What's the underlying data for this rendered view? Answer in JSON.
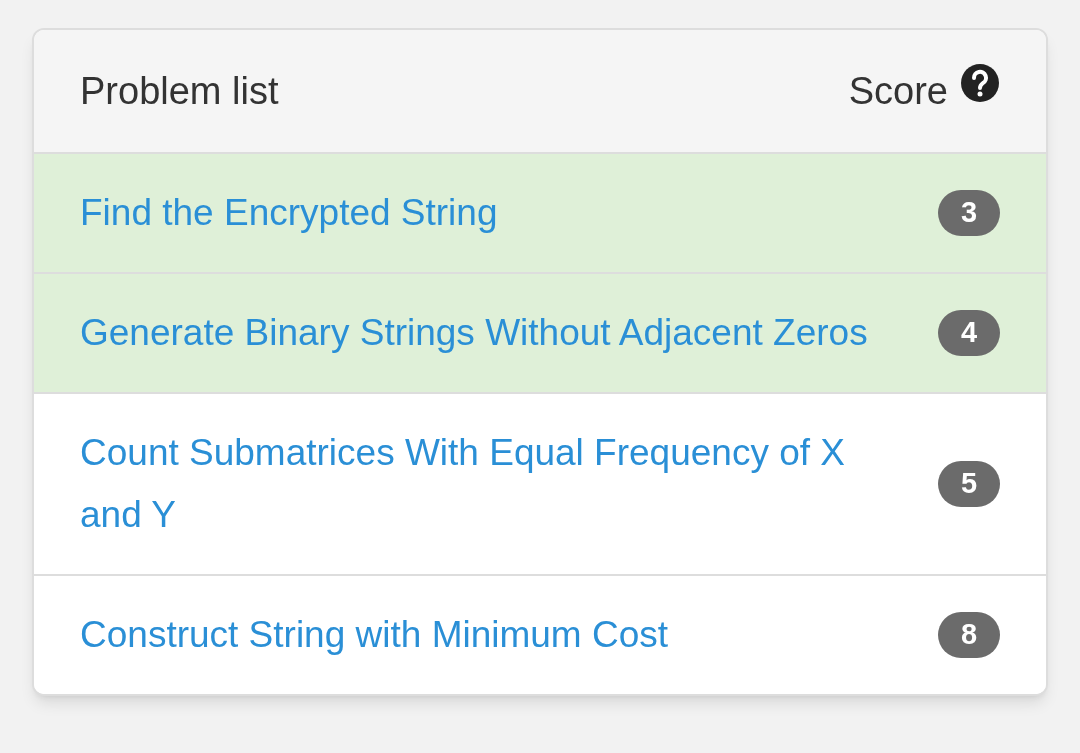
{
  "header": {
    "title": "Problem list",
    "score_label": "Score"
  },
  "problems": [
    {
      "title": "Find the Encrypted String",
      "score": "3",
      "solved": true
    },
    {
      "title": "Generate Binary Strings Without Adjacent Zeros",
      "score": "4",
      "solved": true
    },
    {
      "title": "Count Submatrices With Equal Frequency of X and Y",
      "score": "5",
      "solved": false
    },
    {
      "title": "Construct String with Minimum Cost",
      "score": "8",
      "solved": false
    }
  ]
}
